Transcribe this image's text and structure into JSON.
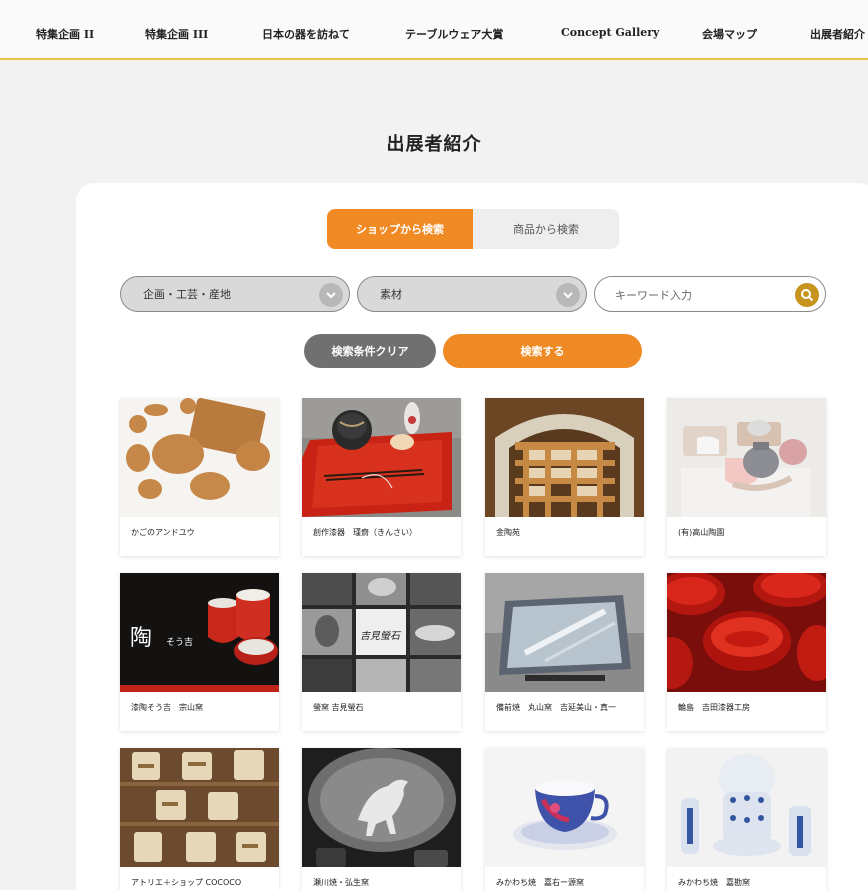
{
  "nav": {
    "items": [
      "特集企画 II",
      "特集企画 III",
      "日本の器を訪ねて",
      "テーブルウェア大賞",
      "Concept Gallery",
      "会場マップ",
      "出展者紹介"
    ]
  },
  "page": {
    "title": "出展者紹介"
  },
  "search": {
    "tab_shop": "ショップから検索",
    "tab_product": "商品から検索",
    "select_category": "企画・工芸・産地",
    "select_material": "素材",
    "keyword_placeholder": "キーワード入力",
    "clear_label": "検索条件クリア",
    "search_label": "検索する"
  },
  "exhibitors": [
    "かごのアンドユウ",
    "創作漆器　瑾齋（きんさい）",
    "金陶苑",
    "(有)高山陶園",
    "漆陶そう吉　宗山窯",
    "螢窯 吉見螢石",
    "備前焼　丸山窯　吉延美山・真一",
    "輪島　吉田漆器工房",
    "アトリエ＋ショップ COCOCO",
    "瀬川焼・弘生窯",
    "みかわち焼　嘉右ー源窯",
    "みかわち焼　嘉勘窯"
  ],
  "thumb_text": {
    "cafe": "陶",
    "cafe2": "そう吉",
    "calligraphy": "吉見螢石"
  },
  "colors": {
    "accent": "#f08a24",
    "gold": "#c6941f",
    "nav_border": "#e8c547"
  }
}
